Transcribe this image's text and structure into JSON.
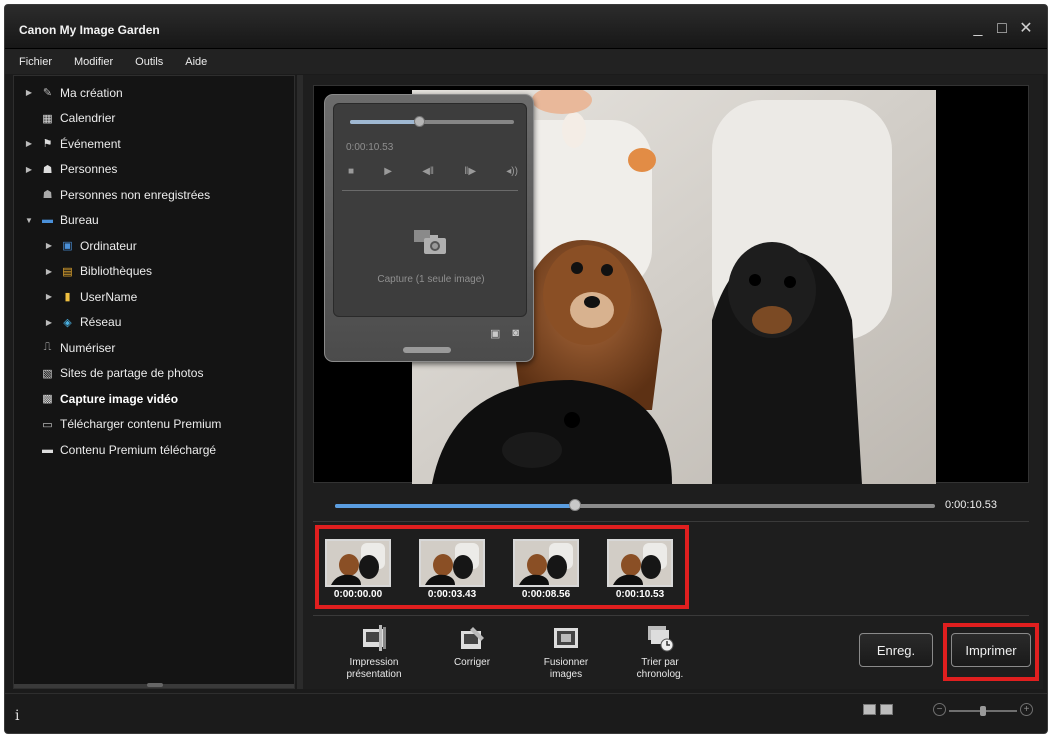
{
  "app": {
    "title": "Canon My Image Garden"
  },
  "window_controls": {
    "minimize": "_",
    "maximize": "□",
    "close": "✕"
  },
  "menu": [
    "Fichier",
    "Modifier",
    "Outils",
    "Aide"
  ],
  "sidebar": {
    "items": [
      {
        "label": "Ma création",
        "icon": "creation-icon",
        "expandable": true,
        "expanded": false,
        "level": 0
      },
      {
        "label": "Calendrier",
        "icon": "calendar-icon",
        "expandable": false,
        "level": 0
      },
      {
        "label": "Événement",
        "icon": "event-icon",
        "expandable": true,
        "expanded": false,
        "level": 0
      },
      {
        "label": "Personnes",
        "icon": "person-icon",
        "expandable": true,
        "expanded": false,
        "level": 0
      },
      {
        "label": "Personnes non enregistrées",
        "icon": "unregistered-person-icon",
        "expandable": false,
        "level": 0
      },
      {
        "label": "Bureau",
        "icon": "desktop-icon",
        "expandable": true,
        "expanded": true,
        "level": 0
      },
      {
        "label": "Ordinateur",
        "icon": "computer-icon",
        "expandable": true,
        "expanded": false,
        "level": 1
      },
      {
        "label": "Bibliothèques",
        "icon": "libraries-icon",
        "expandable": true,
        "expanded": false,
        "level": 1
      },
      {
        "label": "UserName",
        "icon": "user-folder-icon",
        "expandable": true,
        "expanded": false,
        "level": 1
      },
      {
        "label": "Réseau",
        "icon": "network-icon",
        "expandable": true,
        "expanded": false,
        "level": 1
      },
      {
        "label": "Numériser",
        "icon": "scan-icon",
        "expandable": false,
        "level": 0
      },
      {
        "label": "Sites de partage de photos",
        "icon": "photo-sharing-icon",
        "expandable": false,
        "level": 0
      },
      {
        "label": "Capture image vidéo",
        "icon": "video-capture-icon",
        "expandable": false,
        "level": 0,
        "selected": true
      },
      {
        "label": "Télécharger contenu Premium",
        "icon": "download-premium-icon",
        "expandable": false,
        "level": 0
      },
      {
        "label": "Contenu Premium téléchargé",
        "icon": "downloaded-premium-icon",
        "expandable": false,
        "level": 0
      }
    ]
  },
  "player_panel": {
    "time": "0:00:10.53",
    "position_fraction": 0.42,
    "capture_label": "Capture (1 seule image)"
  },
  "timeline": {
    "time": "0:00:10.53",
    "position_fraction": 0.4
  },
  "thumbnails": [
    {
      "time": "0:00:00.00"
    },
    {
      "time": "0:00:03.43"
    },
    {
      "time": "0:00:08.56"
    },
    {
      "time": "0:00:10.53"
    }
  ],
  "toolbar": {
    "tools": [
      {
        "line1": "Impression",
        "line2": "présentation",
        "icon": "layout-print-icon"
      },
      {
        "line1": "Corriger",
        "line2": "",
        "icon": "correct-icon"
      },
      {
        "line1": "Fusionner",
        "line2": "images",
        "icon": "merge-images-icon"
      },
      {
        "line1": "Trier par",
        "line2": "chronolog.",
        "icon": "sort-chronological-icon"
      }
    ],
    "save_label": "Enreg.",
    "print_label": "Imprimer"
  },
  "status": {
    "info": "i"
  },
  "colors": {
    "highlight": "#e01f1f",
    "progress": "#5a9de0"
  }
}
